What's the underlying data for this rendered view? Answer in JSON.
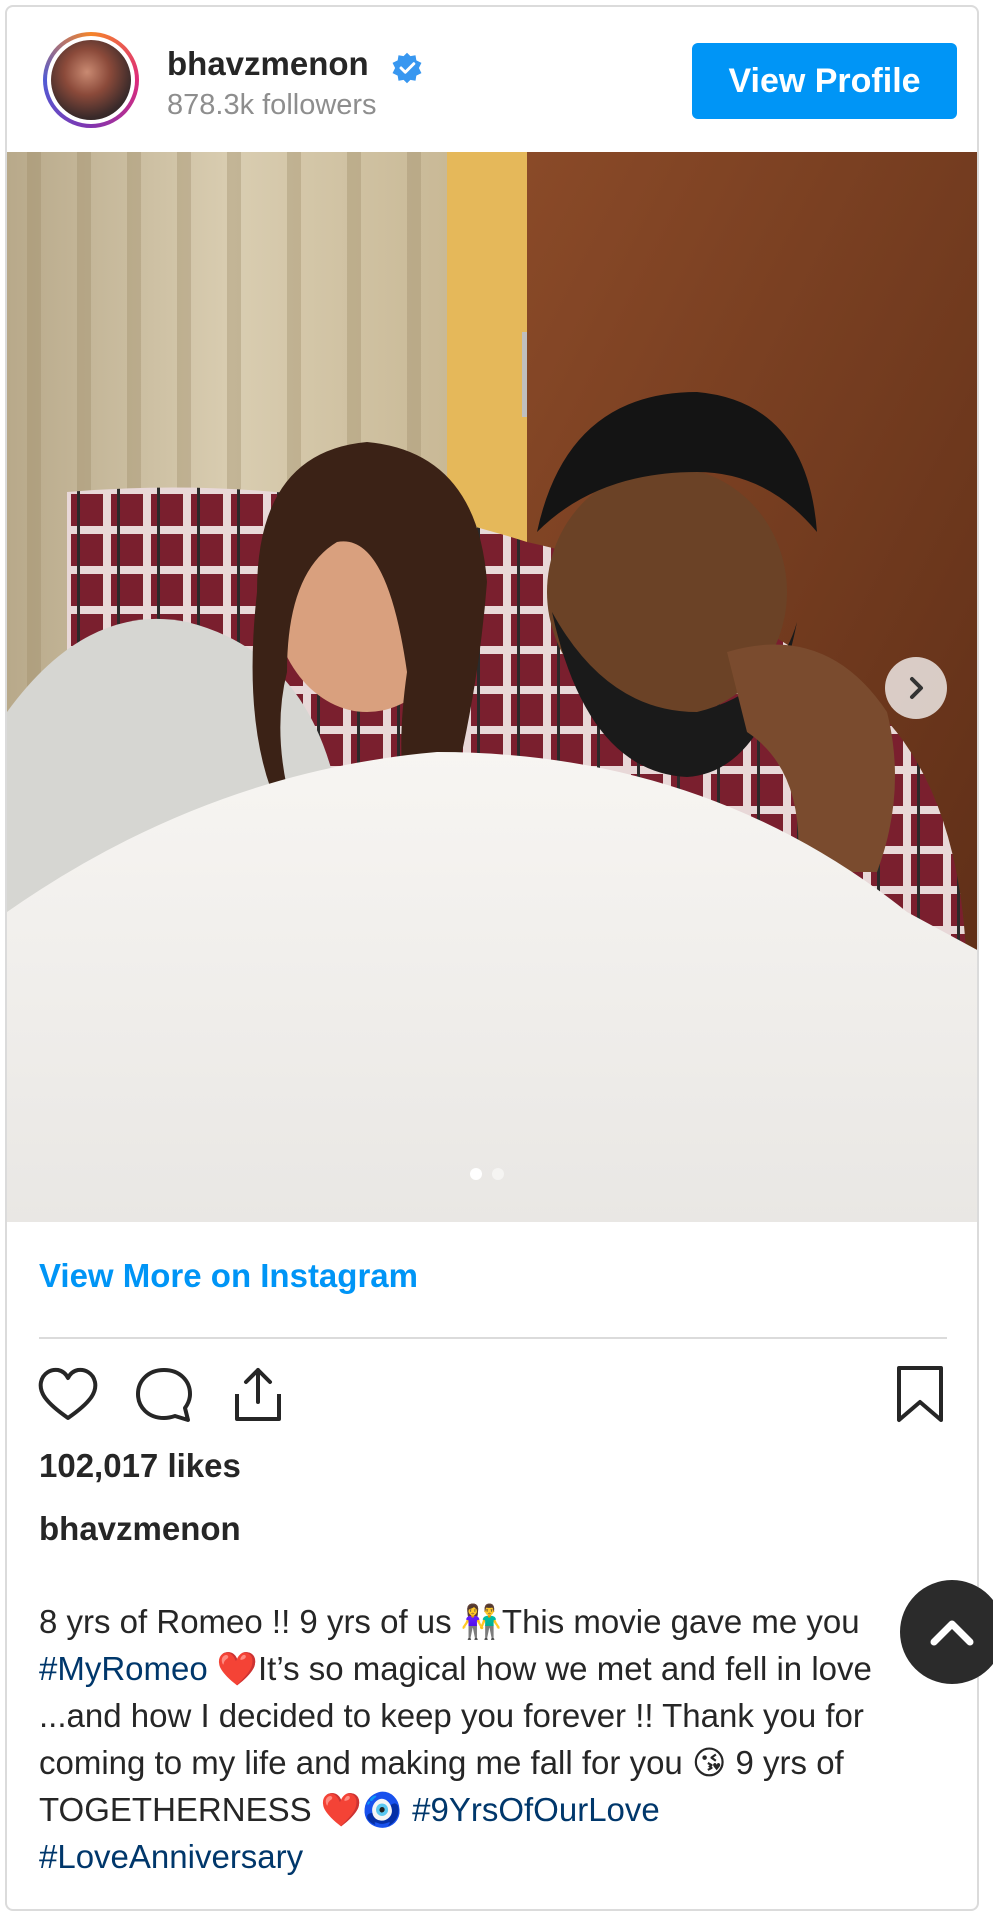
{
  "header": {
    "username": "bhavzmenon",
    "followers": "878.3k followers",
    "view_profile_label": "View Profile"
  },
  "post": {
    "view_more_label": "View More on Instagram",
    "likes": "102,017 likes",
    "caption_user": "bhavzmenon",
    "caption_parts": {
      "p1": "8 yrs of Romeo !! 9 yrs of us ",
      "e1": "👫",
      "p2": "This movie gave me you ",
      "h1": "#MyRomeo",
      "e2": " ❤️",
      "p3": "It’s so magical how we met and fell in love ...and how I decided to keep you forever !! Thank you for coming to my life and making me fall for you ",
      "e3": "😘",
      "p4": " 9 yrs of TOGETHERNESS ",
      "e4": "❤️🧿",
      "h2": " #9YrsOfOurLove",
      "h3": "#LoveAnniversary"
    },
    "carousel": {
      "slides": 2,
      "active": 1
    }
  },
  "colors": {
    "accent": "#0095f6",
    "hashtag": "#00376b",
    "verified": "#3897f0"
  },
  "icons": [
    "verified-badge-icon",
    "chevron-right-icon",
    "heart-icon",
    "comment-icon",
    "share-icon",
    "bookmark-icon",
    "chevron-up-icon"
  ]
}
